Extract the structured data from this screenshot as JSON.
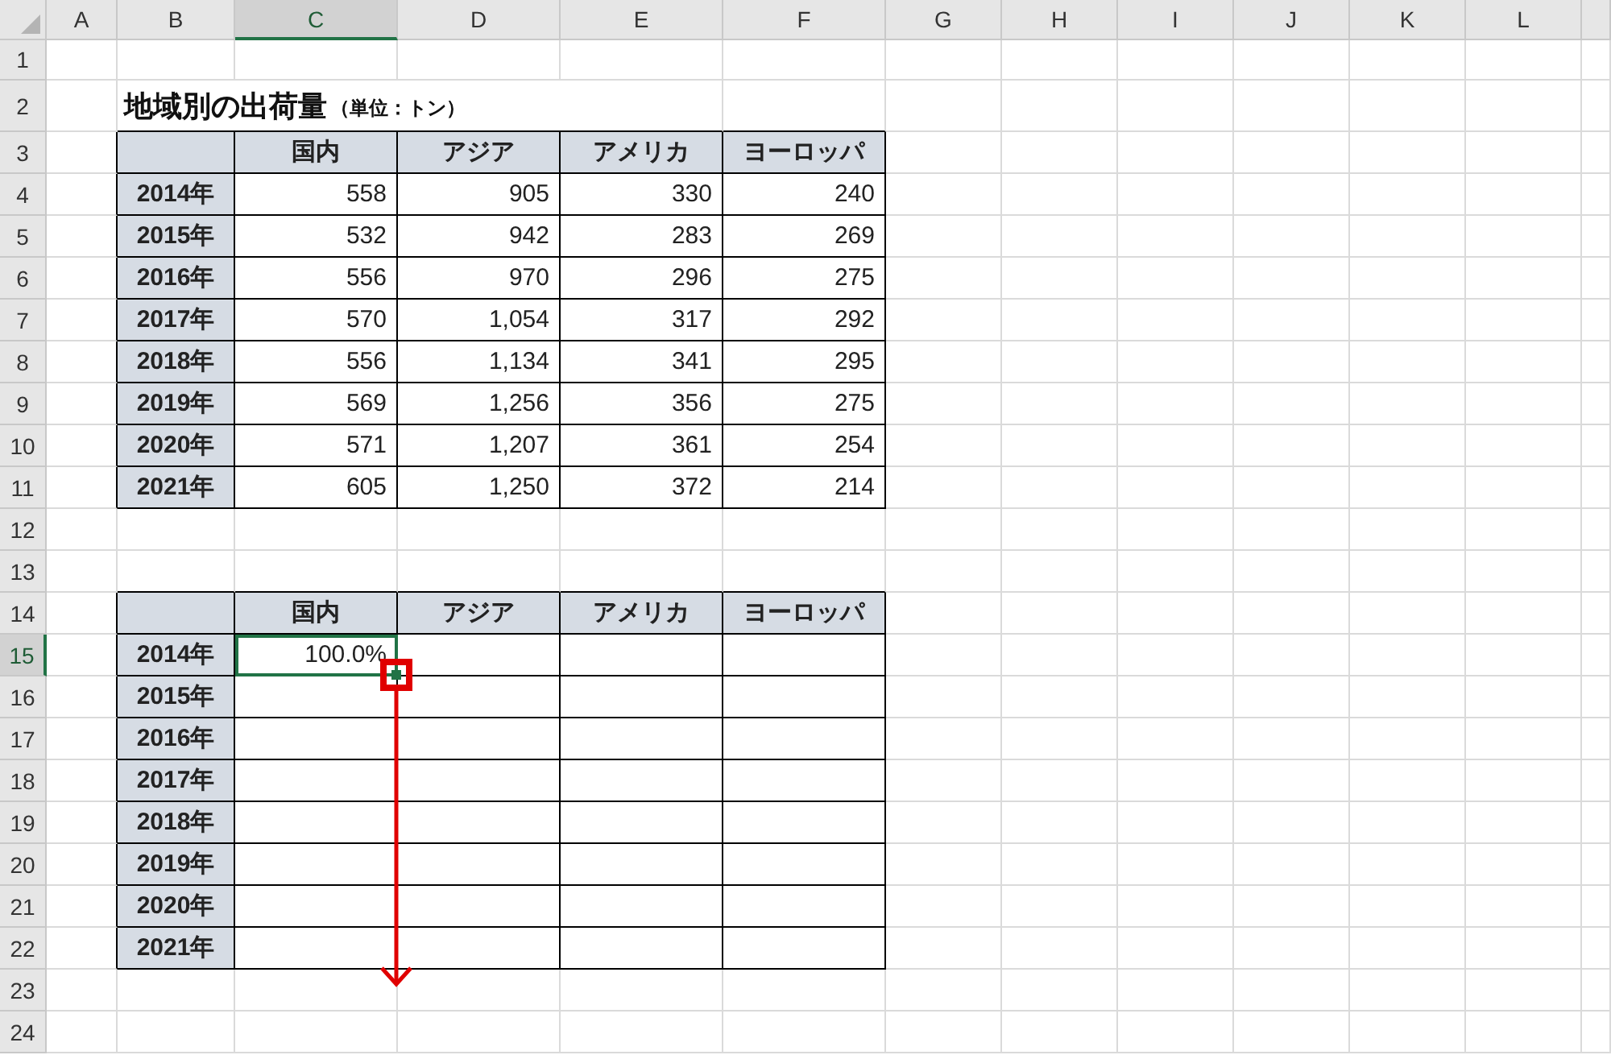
{
  "sheet": {
    "columns": [
      {
        "label": "A",
        "selected": false
      },
      {
        "label": "B",
        "selected": false
      },
      {
        "label": "C",
        "selected": true
      },
      {
        "label": "D",
        "selected": false
      },
      {
        "label": "E",
        "selected": false
      },
      {
        "label": "F",
        "selected": false
      },
      {
        "label": "G",
        "selected": false
      },
      {
        "label": "H",
        "selected": false
      },
      {
        "label": "I",
        "selected": false
      },
      {
        "label": "J",
        "selected": false
      },
      {
        "label": "K",
        "selected": false
      },
      {
        "label": "L",
        "selected": false
      }
    ],
    "rows": [
      {
        "label": "1",
        "selected": false
      },
      {
        "label": "2",
        "selected": false
      },
      {
        "label": "3",
        "selected": false
      },
      {
        "label": "4",
        "selected": false
      },
      {
        "label": "5",
        "selected": false
      },
      {
        "label": "6",
        "selected": false
      },
      {
        "label": "7",
        "selected": false
      },
      {
        "label": "8",
        "selected": false
      },
      {
        "label": "9",
        "selected": false
      },
      {
        "label": "10",
        "selected": false
      },
      {
        "label": "11",
        "selected": false
      },
      {
        "label": "12",
        "selected": false
      },
      {
        "label": "13",
        "selected": false
      },
      {
        "label": "14",
        "selected": false
      },
      {
        "label": "15",
        "selected": true
      },
      {
        "label": "16",
        "selected": false
      },
      {
        "label": "17",
        "selected": false
      },
      {
        "label": "18",
        "selected": false
      },
      {
        "label": "19",
        "selected": false
      },
      {
        "label": "20",
        "selected": false
      },
      {
        "label": "21",
        "selected": false
      },
      {
        "label": "22",
        "selected": false
      },
      {
        "label": "23",
        "selected": false
      },
      {
        "label": "24",
        "selected": false
      }
    ]
  },
  "title": {
    "text": "地域別の出荷量",
    "unit": "（単位：トン）"
  },
  "tables": [
    {
      "header": [
        "国内",
        "アジア",
        "アメリカ",
        "ヨーロッパ"
      ],
      "rows": [
        {
          "label": "2014年",
          "values": [
            "558",
            "905",
            "330",
            "240"
          ]
        },
        {
          "label": "2015年",
          "values": [
            "532",
            "942",
            "283",
            "269"
          ]
        },
        {
          "label": "2016年",
          "values": [
            "556",
            "970",
            "296",
            "275"
          ]
        },
        {
          "label": "2017年",
          "values": [
            "570",
            "1,054",
            "317",
            "292"
          ]
        },
        {
          "label": "2018年",
          "values": [
            "556",
            "1,134",
            "341",
            "295"
          ]
        },
        {
          "label": "2019年",
          "values": [
            "569",
            "1,256",
            "356",
            "275"
          ]
        },
        {
          "label": "2020年",
          "values": [
            "571",
            "1,207",
            "361",
            "254"
          ]
        },
        {
          "label": "2021年",
          "values": [
            "605",
            "1,250",
            "372",
            "214"
          ]
        }
      ]
    },
    {
      "header": [
        "国内",
        "アジア",
        "アメリカ",
        "ヨーロッパ"
      ],
      "rows": [
        {
          "label": "2014年",
          "values": [
            "100.0%"
          ]
        },
        {
          "label": "2015年",
          "values": []
        },
        {
          "label": "2016年",
          "values": []
        },
        {
          "label": "2017年",
          "values": []
        },
        {
          "label": "2018年",
          "values": []
        },
        {
          "label": "2019年",
          "values": []
        },
        {
          "label": "2020年",
          "values": []
        },
        {
          "label": "2021年",
          "values": []
        }
      ]
    }
  ]
}
